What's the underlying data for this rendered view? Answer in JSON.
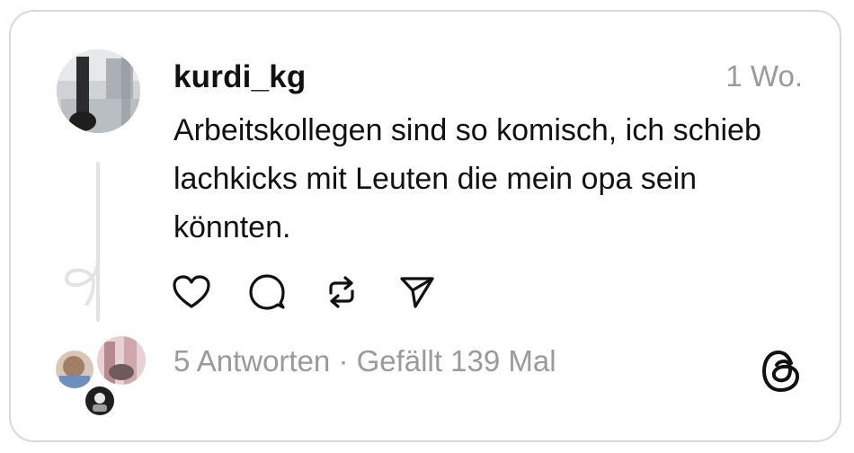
{
  "post": {
    "username": "kurdi_kg",
    "timestamp": "1 Wo.",
    "text": "Arbeitskollegen sind so komisch, ich schieb lachkicks mit Leuten die mein opa sein könnten."
  },
  "actions": [
    {
      "name": "like-button",
      "icon": "heart-icon"
    },
    {
      "name": "reply-button",
      "icon": "comment-icon"
    },
    {
      "name": "repost-button",
      "icon": "repost-icon"
    },
    {
      "name": "share-button",
      "icon": "send-icon"
    }
  ],
  "footer": {
    "replies": "5 Antworten",
    "separator": " · ",
    "likes": "Gefällt 139 Mal"
  },
  "colors": {
    "border": "#d9d9d9",
    "muted_text": "#9a9a9a",
    "primary_text": "#111111",
    "thread_line": "#e3e3e3"
  }
}
